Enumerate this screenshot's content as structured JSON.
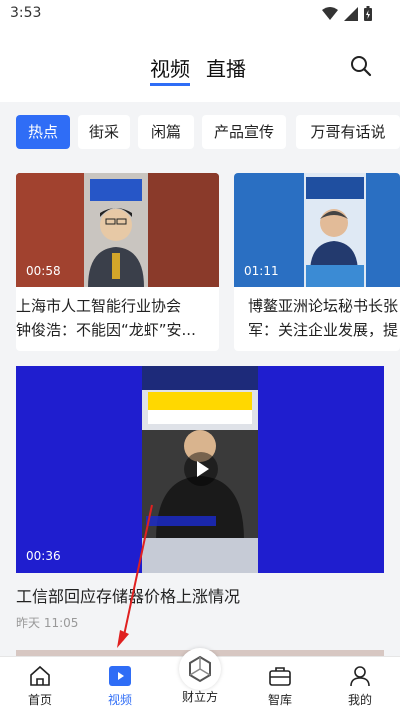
{
  "status": {
    "time": "3:53"
  },
  "header": {
    "tabs": [
      "视频",
      "直播"
    ]
  },
  "categories": [
    "热点",
    "街采",
    "闲篇",
    "产品宣传",
    "万哥有话说"
  ],
  "cards": [
    {
      "duration": "00:58",
      "title_line1": "上海市人工智能行业协会",
      "title_line2": "钟俊浩：不能因“龙虾”安..."
    },
    {
      "duration": "01:11",
      "title_line1": "博鳌亚洲论坛秘书长张",
      "title_line2": "军：关注企业发展，提"
    }
  ],
  "featured": {
    "duration": "00:36",
    "title": "工信部回应存储器价格上涨情况",
    "time": "昨天 11:05"
  },
  "tab_bar": {
    "items": [
      "首页",
      "视频",
      "财立方",
      "智库",
      "我的"
    ],
    "accent": "#2f6df6"
  }
}
